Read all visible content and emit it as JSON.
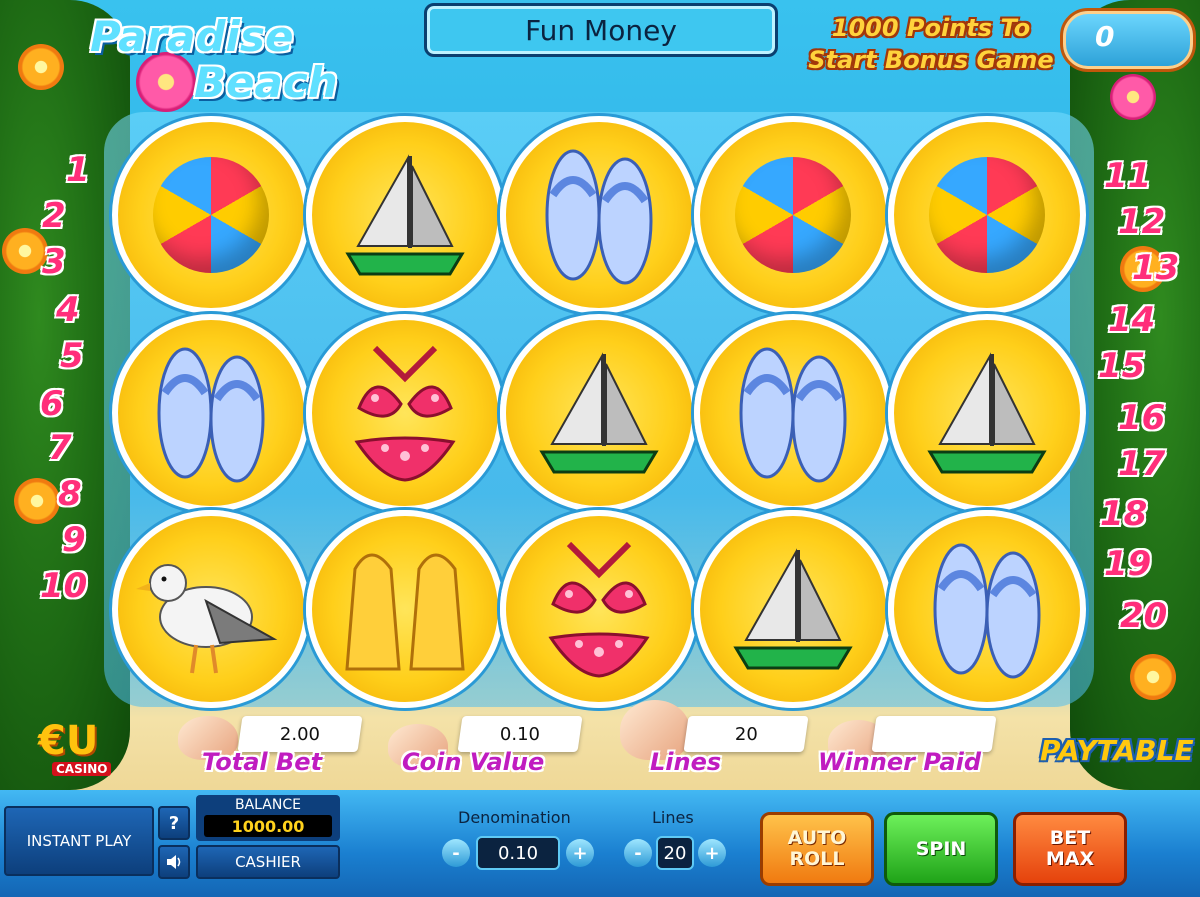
{
  "logo": {
    "line1": "Paradise",
    "line2": "Beach"
  },
  "header": {
    "mode": "Fun Money"
  },
  "bonus": {
    "text": "1000 Points To Start Bonus Game",
    "value": "0"
  },
  "paylines": {
    "left": [
      "1",
      "2",
      "3",
      "4",
      "5",
      "6",
      "7",
      "8",
      "9",
      "10"
    ],
    "right": [
      "11",
      "12",
      "13",
      "14",
      "15",
      "16",
      "17",
      "18",
      "19",
      "20"
    ]
  },
  "reels": [
    [
      "beach-ball",
      "sailboat",
      "flip-flops",
      "beach-ball",
      "beach-ball"
    ],
    [
      "flip-flops",
      "bikini",
      "sailboat",
      "flip-flops",
      "sailboat"
    ],
    [
      "seagull",
      "flippers",
      "bikini",
      "sailboat",
      "flip-flops"
    ]
  ],
  "stats": {
    "total_bet": {
      "label": "Total Bet",
      "value": "2.00"
    },
    "coin_value": {
      "label": "Coin Value",
      "value": "0.10"
    },
    "lines": {
      "label": "Lines",
      "value": "20"
    },
    "winner_paid": {
      "label": "Winner Paid",
      "value": ""
    }
  },
  "casino_logo": {
    "main": "€U",
    "sub": "CASINO"
  },
  "paytable_label": "PAYTABLE",
  "controls": {
    "instant_play": "INSTANT PLAY",
    "help": "?",
    "sound_icon": "speaker-icon",
    "balance_label": "BALANCE",
    "balance_value": "1000.00",
    "cashier": "CASHIER",
    "denomination_label": "Denomination",
    "denomination_value": "0.10",
    "lines_label": "Lines",
    "lines_value": "20",
    "minus": "-",
    "plus": "+",
    "auto_roll": "AUTO\nROLL",
    "spin": "SPIN",
    "bet_max": "BET\nMAX"
  },
  "colors": {
    "sky": "#39c2ef",
    "reel_gold": "#ffcf1a",
    "line_numbers": "#ff2e7a",
    "stat_labels": "#c01cc0",
    "spin_green": "#1fa318"
  }
}
